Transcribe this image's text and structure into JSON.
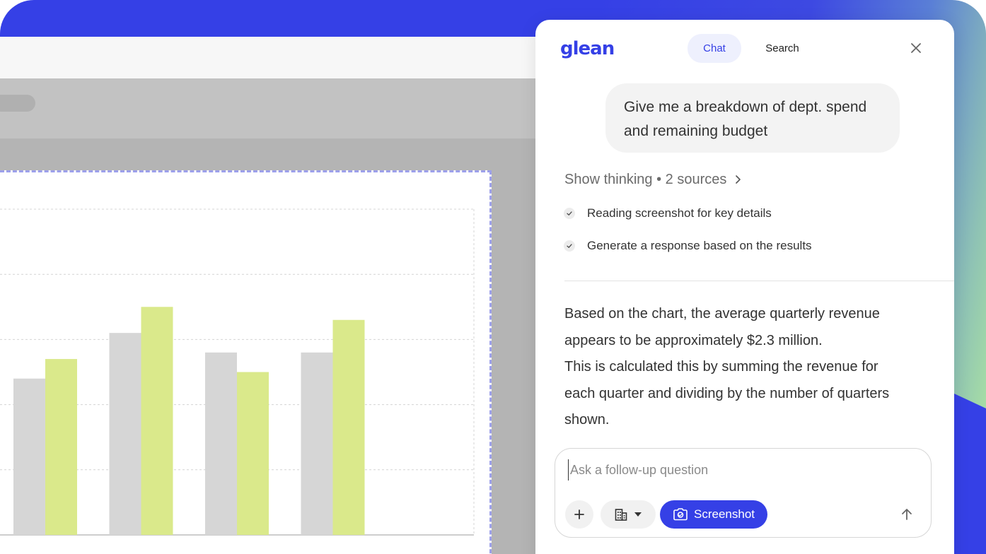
{
  "colors": {
    "brand": "#3540e6",
    "bar_gray": "#d6d6d6",
    "bar_green": "#dae98b",
    "selection_dash": "#9da0ea"
  },
  "panel": {
    "logo": "glean",
    "tabs": [
      {
        "label": "Chat",
        "active": true
      },
      {
        "label": "Search",
        "active": false
      }
    ],
    "close_icon": "close-icon",
    "user_message": "Give me a breakdown of dept. spend and remaining budget",
    "thinking": {
      "label": "Show thinking • 2 sources",
      "icon": "chevron-right-icon"
    },
    "steps": [
      {
        "icon": "check-icon",
        "text": "Reading screenshot for key details"
      },
      {
        "icon": "check-icon",
        "text": "Generate a response based on the results"
      }
    ],
    "answer_lines": [
      "Based on the chart, the average quarterly revenue",
      "appears to be approximately $2.3 million.",
      "This is calculated this by summing the revenue for",
      "each quarter and dividing by the number of quarters",
      "shown."
    ],
    "composer": {
      "placeholder": "Ask a follow-up question",
      "value": "",
      "plus_icon": "plus-icon",
      "org_icon": "building-icon",
      "dropdown_icon": "caret-down-icon",
      "screenshot_icon": "camera-icon",
      "screenshot_label": "Screenshot",
      "send_icon": "arrow-up-icon"
    }
  },
  "chart_data": {
    "type": "bar",
    "categories": [
      "",
      "",
      "",
      ""
    ],
    "series": [
      {
        "values": [
          2.4,
          3.1,
          2.8,
          2.8
        ],
        "color": "#d6d6d6"
      },
      {
        "values": [
          2.7,
          3.5,
          2.5,
          3.3
        ],
        "color": "#dae98b"
      }
    ],
    "ylim": [
      0,
      5
    ],
    "grid": true
  }
}
